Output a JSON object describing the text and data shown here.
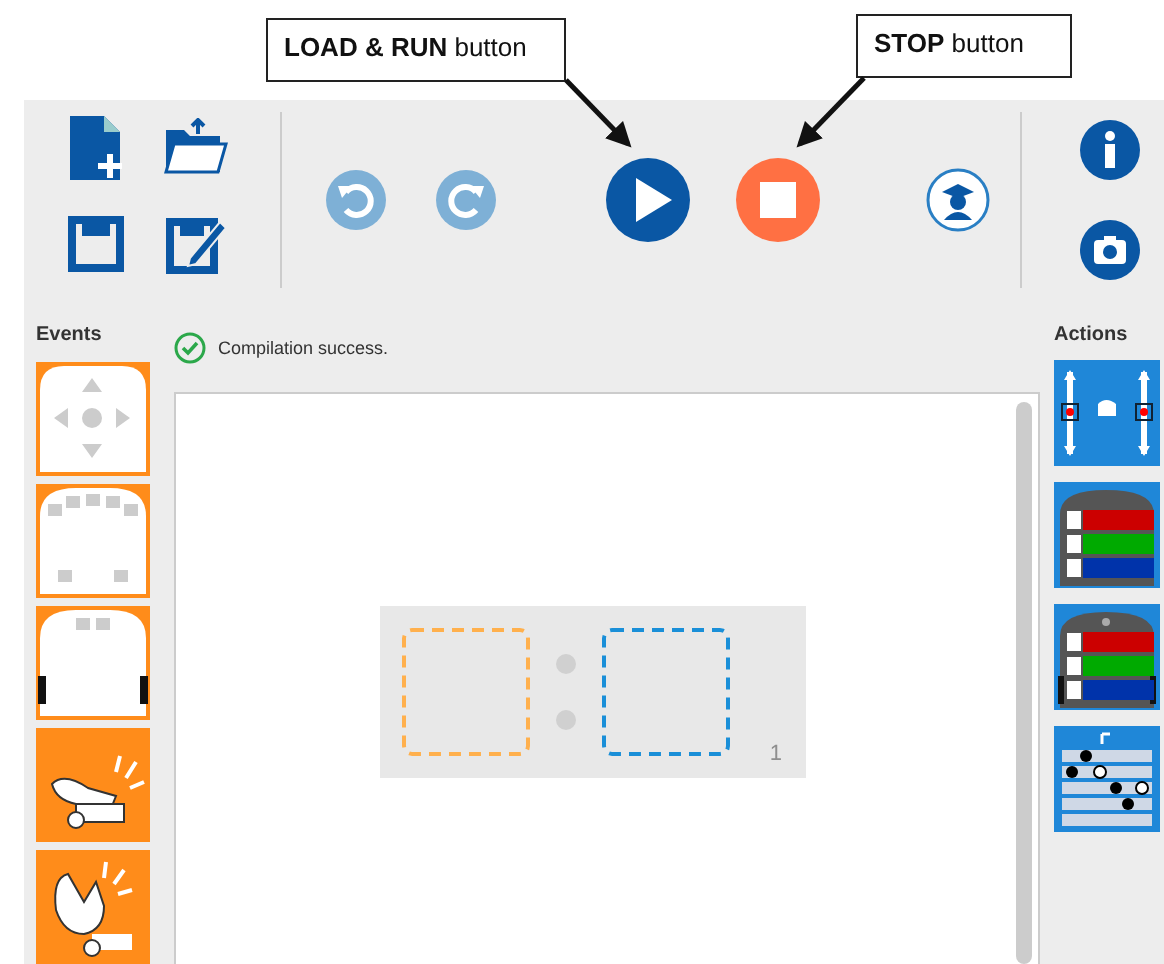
{
  "callouts": [
    {
      "text": "**LOAD & RUN** button"
    },
    {
      "text": "**STOP** button"
    }
  ],
  "toolbar": {
    "undo": {
      "disabled": true
    },
    "redo": {
      "disabled": true
    }
  },
  "events": {
    "label": "Events",
    "blocks": [
      {
        "kind": "buttons"
      },
      {
        "kind": "proximity"
      },
      {
        "kind": "ground"
      },
      {
        "kind": "tap"
      },
      {
        "kind": "clap"
      }
    ]
  },
  "status": {
    "ok": true,
    "text": "Compilation success."
  },
  "program": {
    "rows": [
      {
        "number": "1"
      }
    ]
  },
  "actions": {
    "label": "Actions",
    "blocks": [
      {
        "kind": "motors"
      },
      {
        "kind": "top-color"
      },
      {
        "kind": "bottom-color"
      },
      {
        "kind": "music"
      }
    ]
  }
}
